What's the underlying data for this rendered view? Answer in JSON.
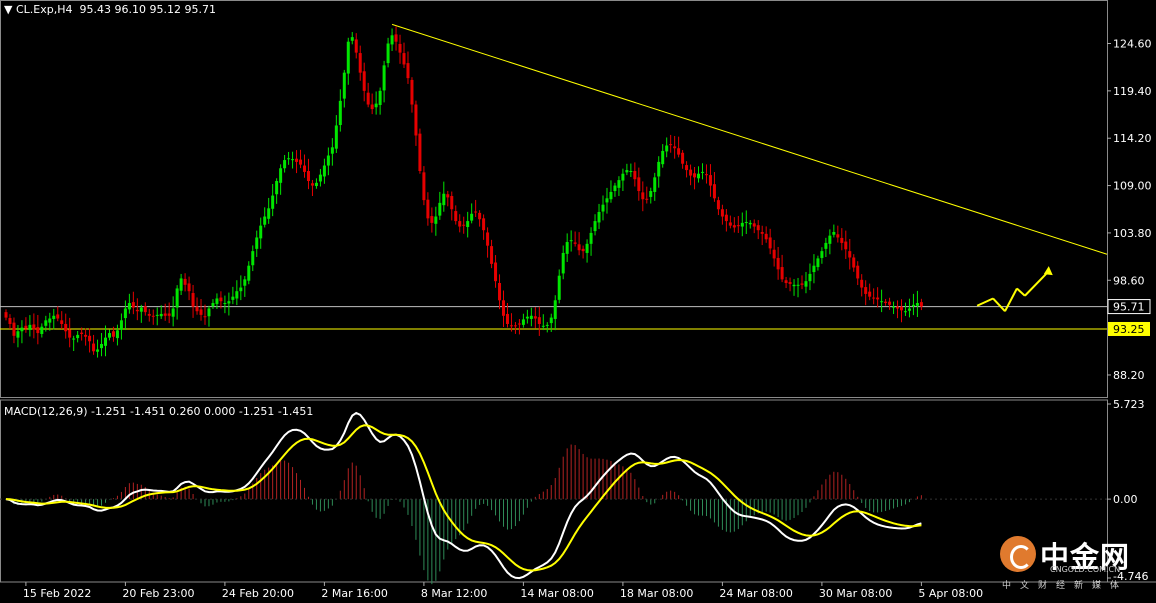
{
  "header": {
    "symbol": "CL.Exp,H4",
    "ohlc": "95.43 96.10 95.12 95.71"
  },
  "macd_header": "MACD(12,26,9) -1.251 -1.451 0.260 0.000 -1.251 -1.451",
  "logo": {
    "text": "中金网",
    "url": "CNGOLD.COM.CN",
    "subtitle": "中文财经新媒体"
  },
  "colors": {
    "background": "#000000",
    "bull": "#00e600",
    "bear": "#e60000",
    "trendline": "#ffff00",
    "macd_line": "#ffffff",
    "signal_line": "#ffff00",
    "hist_pos": "#b22222",
    "hist_neg": "#2e8b57"
  },
  "chart_data": [
    {
      "type": "candlestick",
      "symbol": "CL.Exp",
      "timeframe": "H4",
      "ylim": [
        86.0,
        128.5
      ],
      "y_ticks": [
        "124.60",
        "119.40",
        "114.20",
        "109.00",
        "103.80",
        "98.60",
        "88.20"
      ],
      "y_tick_values": [
        124.6,
        119.4,
        114.2,
        109.0,
        103.8,
        98.6,
        88.2
      ],
      "x_ticks": [
        "15 Feb 2022",
        "20 Feb 23:00",
        "24 Feb 20:00",
        "2 Mar 16:00",
        "8 Mar 12:00",
        "14 Mar 08:00",
        "18 Mar 08:00",
        "24 Mar 08:00",
        "30 Mar 08:00",
        "5 Apr 08:00"
      ],
      "x_tick_index": [
        5,
        30,
        55,
        80,
        105,
        130,
        155,
        180,
        205,
        230
      ],
      "current_price": {
        "value": 95.71,
        "label": "95.71"
      },
      "support_line": {
        "value": 93.25,
        "label": "93.25"
      },
      "trendline": {
        "from": {
          "index": 97,
          "price": 126.7
        },
        "to": {
          "index": 287,
          "price": 100.0
        }
      },
      "projection_path": [
        {
          "index": 244,
          "price": 95.8
        },
        {
          "index": 248,
          "price": 96.6
        },
        {
          "index": 251,
          "price": 95.2
        },
        {
          "index": 254,
          "price": 97.7
        },
        {
          "index": 256,
          "price": 96.9
        },
        {
          "index": 262,
          "price": 99.6
        }
      ],
      "closes": [
        94.5,
        93.8,
        92.5,
        93.0,
        93.4,
        93.3,
        93.7,
        93.2,
        92.8,
        93.5,
        94.2,
        94.4,
        94.7,
        94.4,
        93.8,
        93.0,
        92.3,
        92.2,
        92.6,
        92.7,
        92.4,
        91.9,
        90.8,
        91.0,
        91.6,
        92.3,
        92.8,
        92.4,
        93.1,
        94.2,
        95.5,
        96.1,
        95.6,
        95.2,
        95.6,
        95.1,
        94.7,
        94.6,
        94.8,
        94.9,
        94.7,
        94.7,
        95.5,
        97.7,
        98.8,
        98.1,
        97.4,
        95.7,
        95.2,
        94.8,
        94.6,
        95.5,
        96.1,
        96.6,
        96.3,
        96.1,
        96.3,
        96.8,
        97.4,
        97.8,
        98.7,
        100.2,
        101.8,
        103.3,
        104.6,
        105.6,
        106.5,
        107.9,
        109.5,
        110.9,
        111.8,
        112.0,
        111.9,
        111.6,
        111.3,
        110.5,
        109.5,
        109.0,
        109.3,
        110.2,
        111.2,
        112.3,
        113.2,
        115.6,
        118.3,
        121.4,
        124.8,
        125.3,
        123.6,
        121.4,
        119.4,
        117.9,
        117.4,
        118.0,
        119.4,
        122.2,
        124.6,
        125.5,
        124.8,
        123.6,
        122.3,
        120.8,
        117.9,
        114.5,
        110.6,
        107.4,
        105.4,
        104.9,
        105.6,
        107.1,
        108.1,
        107.7,
        106.4,
        105.1,
        104.5,
        104.6,
        105.1,
        105.9,
        106.1,
        105.3,
        104.1,
        102.4,
        100.4,
        98.5,
        96.4,
        94.7,
        93.8,
        93.6,
        93.6,
        93.8,
        94.3,
        94.6,
        94.7,
        94.4,
        93.8,
        93.6,
        93.7,
        94.5,
        96.4,
        99.1,
        101.6,
        102.8,
        103.0,
        102.6,
        101.9,
        101.8,
        102.6,
        103.8,
        105.1,
        106.1,
        106.9,
        107.6,
        108.3,
        109.0,
        109.6,
        110.3,
        110.7,
        110.6,
        109.7,
        108.4,
        107.5,
        107.5,
        108.4,
        109.9,
        111.6,
        112.8,
        113.4,
        113.5,
        113.1,
        112.4,
        111.4,
        110.7,
        110.1,
        109.9,
        110.3,
        110.5,
        110.2,
        109.0,
        107.6,
        106.4,
        105.6,
        105.1,
        104.6,
        104.4,
        104.6,
        104.9,
        105.0,
        104.9,
        104.5,
        104.1,
        103.7,
        103.1,
        102.1,
        101.0,
        99.8,
        98.7,
        98.3,
        98.2,
        98.1,
        98.1,
        98.1,
        98.5,
        99.3,
        100.2,
        101.0,
        101.8,
        102.7,
        103.5,
        103.9,
        103.3,
        102.7,
        102.0,
        101.1,
        100.0,
        98.8,
        97.8,
        97.1,
        96.8,
        96.6,
        96.5,
        96.3,
        96.1,
        95.9,
        95.7,
        95.5,
        95.3,
        95.2,
        95.5,
        95.9,
        96.1,
        95.71
      ],
      "macd": {
        "ylim": [
          -4.746,
          5.723
        ],
        "y_ticks": [
          "5.723",
          "0.00",
          "-4.746"
        ],
        "y_tick_values": [
          5.723,
          0.0,
          -4.746
        ]
      }
    }
  ]
}
